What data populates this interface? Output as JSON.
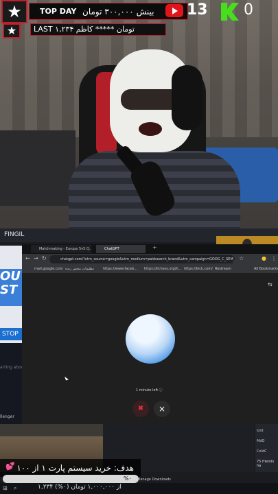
{
  "top_overlay": {
    "donate": {
      "top_label": "TOP DAY",
      "text": "بینش ۳۰۰,۰۰۰ تومان",
      "platform_icon": "youtube-icon"
    },
    "youtube_viewers": "13",
    "kick_viewers": "0",
    "last_donation": "LAST ۱,۲۳۴ تومان ***** کاظم",
    "star_icon": "star-icon"
  },
  "screen_share": {
    "window_label": "FINGIL",
    "left_panel": {
      "title": "OU\nST",
      "stop_button": "STOP",
      "text1": "arting about",
      "text2": "llenger"
    },
    "tabs": [
      {
        "label": "Matchmaking - Europe 5v5 Q..."
      },
      {
        "label": "ChatGPT"
      }
    ],
    "address_url": "chatgpt.com/?utm_source=google&utm_medium=paidsearch_brand&utm_campaign=GOOG_C_SEM_...",
    "bookmarks": [
      "mail.google.com",
      "تنظیمات مخش زنده",
      "https://www.faceb...",
      "https://lichess.org/h...",
      "https://kick.com/",
      "Restream"
    ],
    "all_bookmarks": "All Bookmarks",
    "voice": {
      "time_left": "1 minute left ⓘ"
    },
    "downloads_label": "Manage Downloads",
    "friends": [
      {
        "name": "lord"
      },
      {
        "name": "MdQ"
      },
      {
        "name": "ColdC"
      }
    ],
    "friends_count": "75 friends ha"
  },
  "goal": {
    "text": "هدف: خرید سیستم پارت ۱ از ۱۰۰",
    "percent_label": "%۰",
    "progress_percent": 0,
    "bottom_text": "۱,۲۳۴ از ۱,۰۰۰,۰۰۰ تومان (۰%)"
  }
}
